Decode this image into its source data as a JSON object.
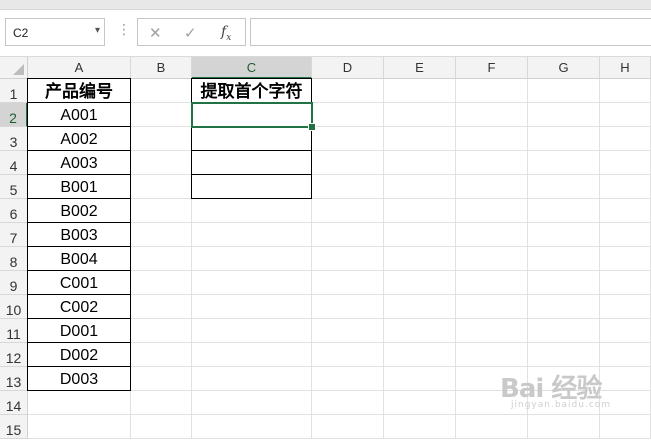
{
  "formula_bar": {
    "name_box": "C2",
    "name_box_dropdown_icon": "chevron-down-icon",
    "cancel_icon": "close-icon",
    "enter_icon": "check-icon",
    "function_icon": "fx",
    "formula": ""
  },
  "sheet": {
    "columns": [
      "A",
      "B",
      "C",
      "D",
      "E",
      "F",
      "G",
      "H"
    ],
    "rows": [
      "1",
      "2",
      "3",
      "4",
      "5",
      "6",
      "7",
      "8",
      "9",
      "10",
      "11",
      "12",
      "13",
      "14",
      "15"
    ],
    "active_cell": "C2",
    "cells": {
      "A1": "产品编号",
      "A2": "A001",
      "A3": "A002",
      "A4": "A003",
      "A5": "B001",
      "A6": "B002",
      "A7": "B003",
      "A8": "B004",
      "A9": "C001",
      "A10": "C002",
      "A11": "D001",
      "A12": "D002",
      "A13": "D003",
      "C1": "提取首个字符"
    }
  },
  "watermark": {
    "text": "Bai 经验",
    "sub": "jingyan.baidu.com"
  },
  "colors": {
    "accent": "#217346",
    "grid": "#e1e1e1",
    "header_bg": "#f3f3f3",
    "header_selected_bg": "#d4d4d4"
  }
}
